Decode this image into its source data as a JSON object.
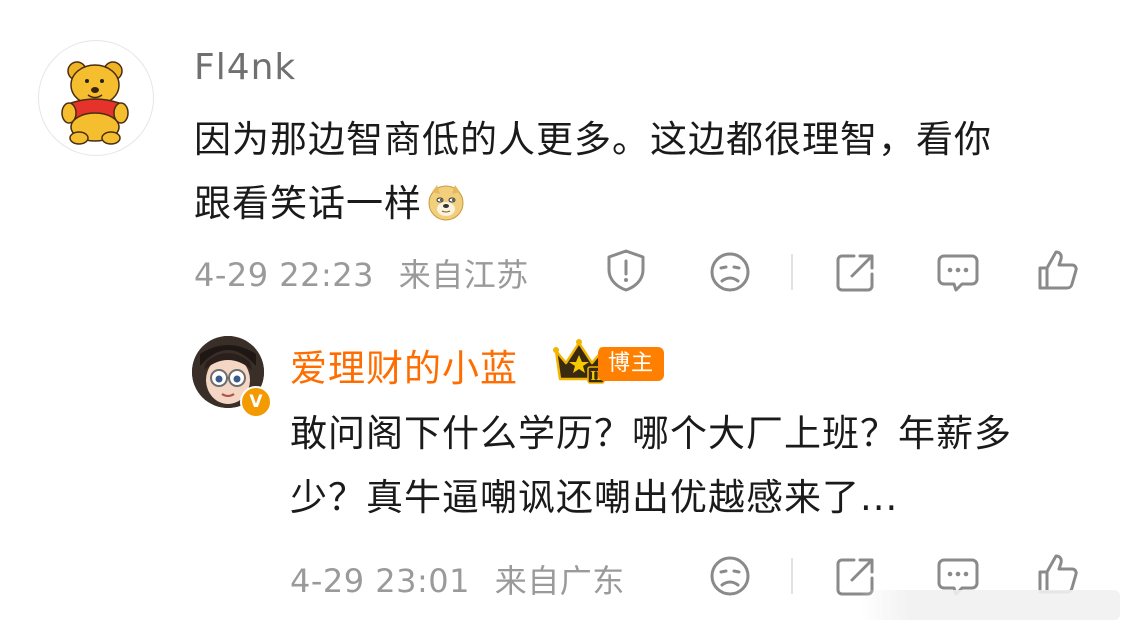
{
  "comment": {
    "username": "Fl4nk",
    "text_line1": "因为那边智商低的人更多。这边都很理智，看你",
    "text_line2": "跟看笑话一样",
    "emoji": "doge-emoji",
    "time": "4-29 22:23",
    "location": "来自江苏",
    "actions": [
      "report-icon",
      "dislike-face-icon",
      "share-icon",
      "reply-icon",
      "like-icon"
    ]
  },
  "reply": {
    "username": "爱理财的小蓝",
    "badge_label": "博主",
    "verified_mark": "V",
    "crown_numeral": "II",
    "text_line1": "敢问阁下什么学历？哪个大厂上班？年薪多",
    "text_line2": "少？真牛逼嘲讽还嘲出优越感来了...",
    "time": "4-29 23:01",
    "location": "来自广东",
    "actions": [
      "dislike-face-icon",
      "share-icon",
      "reply-icon",
      "like-icon"
    ]
  },
  "colors": {
    "username_primary": "#707070",
    "username_blogger": "#ff6d00",
    "badge_bg": "#ff8000",
    "meta_text": "#9a9a9a",
    "verified": "#f39a00"
  }
}
